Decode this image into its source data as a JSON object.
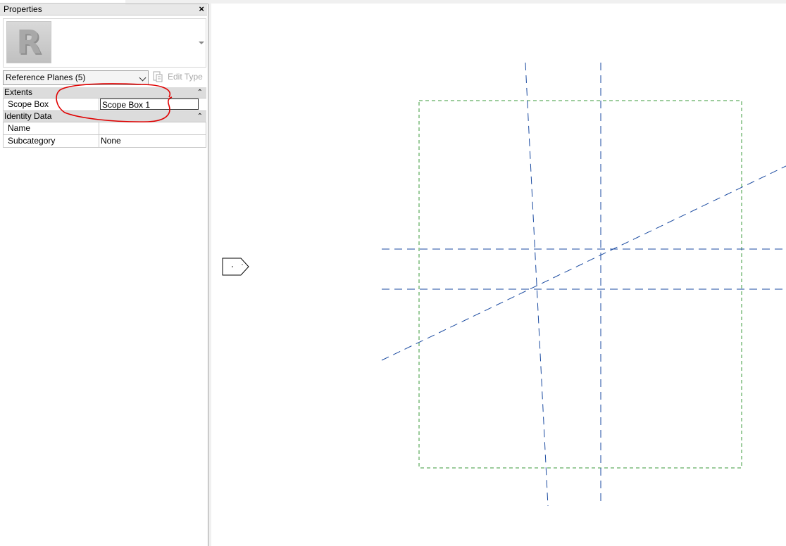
{
  "properties": {
    "title": "Properties",
    "close_icon": "×",
    "type_logo_letter": "R",
    "type_selector": "Reference Planes (5)",
    "edit_type_label": "Edit Type",
    "groups": [
      {
        "label": "Extents",
        "collapse_icon": "⌃",
        "rows": [
          {
            "name": "Scope Box",
            "value": "Scope Box 1"
          }
        ]
      },
      {
        "label": "Identity Data",
        "collapse_icon": "⌃",
        "rows": [
          {
            "name": "Name",
            "value": ""
          },
          {
            "name": "Subcategory",
            "value": "None"
          }
        ]
      }
    ]
  },
  "colors": {
    "reference_plane": "#1a4aa0",
    "scope_box": "#3a9a3a",
    "annotation_circle": "#e00000"
  }
}
